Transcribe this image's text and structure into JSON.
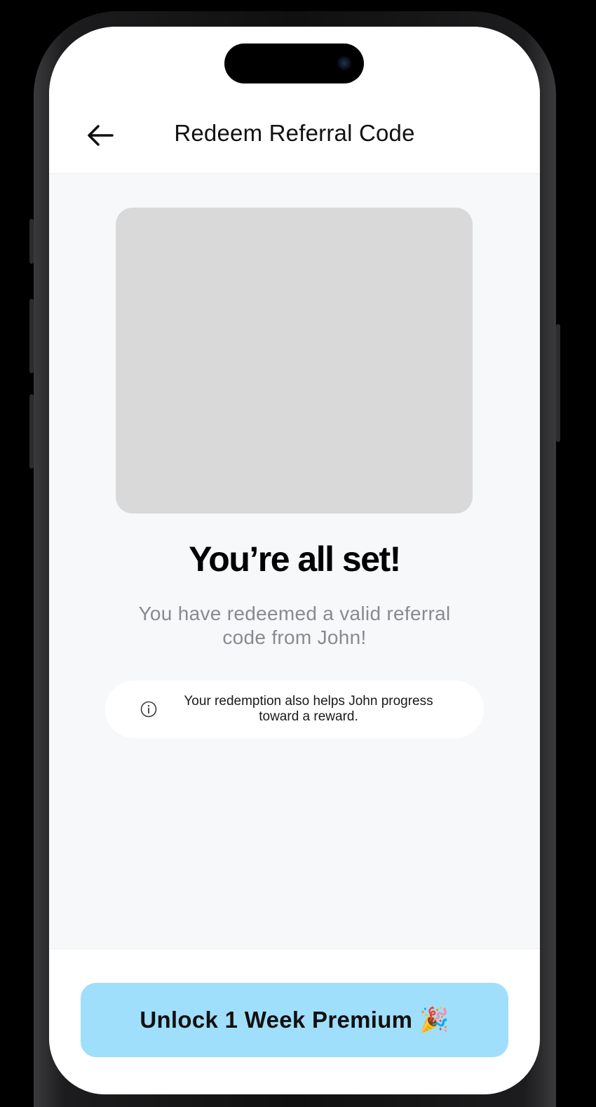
{
  "header": {
    "title": "Redeem Referral Code",
    "back_icon": "arrow-left-icon"
  },
  "main": {
    "headline": "You’re all set!",
    "subtext": "You have redeemed a valid referral code from John!",
    "info": {
      "icon": "info-circle-icon",
      "text": "Your redemption also helps John progress toward a reward."
    }
  },
  "footer": {
    "cta_label": "Unlock 1 Week Premium",
    "cta_emoji": "🎉",
    "cta_color": "#a0dffb"
  },
  "colors": {
    "screen_background": "#f7f8fa",
    "placeholder": "#d9d9d9",
    "subtext": "#8a8a8e"
  }
}
